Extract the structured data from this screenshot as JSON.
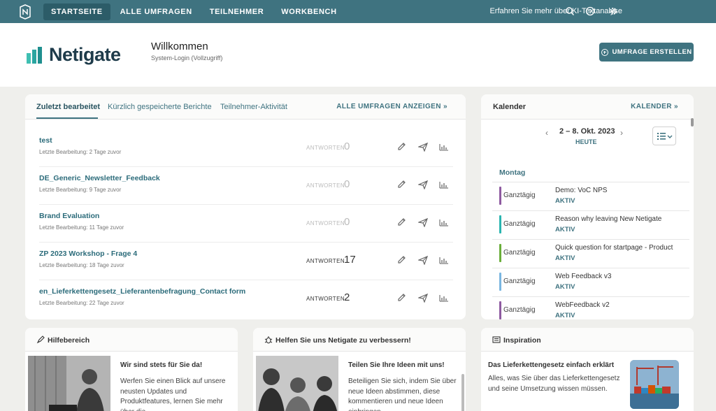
{
  "nav": {
    "items": [
      "STARTSEITE",
      "ALLE UMFRAGEN",
      "TEILNEHMER",
      "WORKBENCH"
    ],
    "promo": "Erfahren Sie mehr über KI-Textanalyse"
  },
  "header": {
    "brand": "Netigate",
    "welcome": "Willkommen",
    "login": "System-Login (Vollzugriff)",
    "create_label": "UMFRAGE ERSTELLEN"
  },
  "surveys": {
    "tabs": [
      "Zuletzt bearbeitet",
      "Kürzlich gespeicherte Berichte",
      "Teilnehmer-Aktivität"
    ],
    "all_link": "ALLE UMFRAGEN ANZEIGEN",
    "answers_label": "ANTWORTEN",
    "rows": [
      {
        "title": "test",
        "sub": "Letzte Bearbeitung: 2 Tage zuvor",
        "answers": "0"
      },
      {
        "title": "DE_Generic_Newsletter_Feedback",
        "sub": "Letzte Bearbeitung: 9 Tage zuvor",
        "answers": "0"
      },
      {
        "title": "Brand Evaluation",
        "sub": "Letzte Bearbeitung: 11 Tage zuvor",
        "answers": "0"
      },
      {
        "title": "ZP 2023 Workshop - Frage 4",
        "sub": "Letzte Bearbeitung: 18 Tage zuvor",
        "answers": "17"
      },
      {
        "title": "en_Lieferkettengesetz_Lieferantenbefragung_Contact form",
        "sub": "Letzte Bearbeitung: 22 Tage zuvor",
        "answers": "2"
      }
    ]
  },
  "calendar": {
    "title": "Kalender",
    "link": "KALENDER",
    "range": "2 – 8. Okt. 2023",
    "today": "HEUTE",
    "day": "Montag",
    "events": [
      {
        "when": "Ganztägig",
        "title": "Demo: VoC NPS",
        "status": "AKTIV",
        "color": "#8e5aa0"
      },
      {
        "when": "Ganztägig",
        "title": "Reason why leaving New Netigate",
        "status": "AKTIV",
        "color": "#2bb5b0"
      },
      {
        "when": "Ganztägig",
        "title": "Quick question for startpage - Product",
        "status": "AKTIV",
        "color": "#6aae3a"
      },
      {
        "when": "Ganztägig",
        "title": "Web Feedback v3",
        "status": "AKTIV",
        "color": "#7ab6e0"
      },
      {
        "when": "Ganztägig",
        "title": "WebFeedback v2",
        "status": "AKTIV",
        "color": "#8e5aa0"
      }
    ]
  },
  "help": {
    "title": "Hilfebereich",
    "heading": "Wir sind stets für Sie da!",
    "body": "Werfen Sie einen Blick auf unsere neusten Updates und Produktfeatures, lernen Sie mehr über die ..."
  },
  "improve": {
    "title": "Helfen Sie uns Netigate zu verbessern!",
    "heading": "Teilen Sie Ihre Ideen mit uns!",
    "body": "Beteiligen Sie sich, indem Sie über neue Ideen abstimmen, diese kommentieren und neue Ideen einbringen. ..."
  },
  "inspiration": {
    "title": "Inspiration",
    "heading": "Das Lieferkettengesetz einfach erklärt",
    "body": "Alles, was Sie über das Lieferkettengesetz und seine Umsetzung wissen müssen."
  }
}
